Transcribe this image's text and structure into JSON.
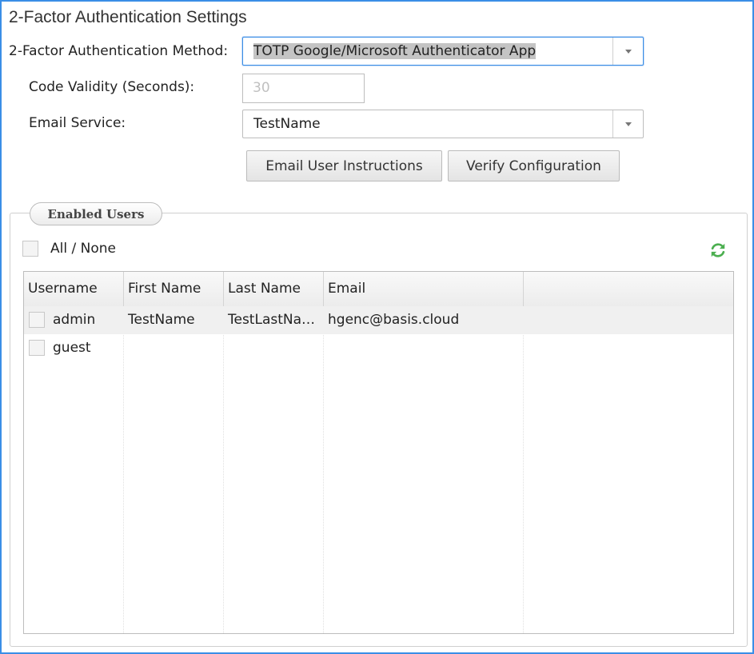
{
  "window": {
    "title": "2-Factor Authentication Settings"
  },
  "form": {
    "method_label": "2-Factor Authentication Method:",
    "method_value": "TOTP Google/Microsoft Authenticator App",
    "validity_label": "Code Validity (Seconds):",
    "validity_value": "30",
    "email_service_label": "Email Service:",
    "email_service_value": "TestName"
  },
  "buttons": {
    "email_instructions": "Email User Instructions",
    "verify_configuration": "Verify Configuration"
  },
  "enabled_users": {
    "legend": "Enabled Users",
    "all_none_label": "All / None",
    "columns": [
      "Username",
      "First Name",
      "Last Name",
      "Email"
    ],
    "rows": [
      {
        "username": "admin",
        "first_name": "TestName",
        "last_name": "TestLastName",
        "email": "hgenc@basis.cloud"
      },
      {
        "username": "guest",
        "first_name": "",
        "last_name": "",
        "email": ""
      }
    ]
  },
  "icons": {
    "dropdown": "chevron-down-icon",
    "refresh": "refresh-icon",
    "refresh_color": "#4caf50"
  },
  "colors": {
    "frame_border": "#3a8ee6"
  }
}
